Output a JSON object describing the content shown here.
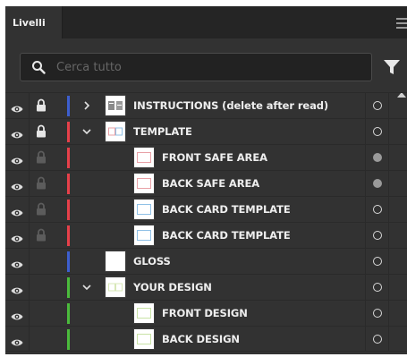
{
  "panel": {
    "tab_label": "Livelli",
    "search": {
      "placeholder": "Cerca tutto",
      "value": ""
    },
    "icons": {
      "search": "search-icon",
      "filter": "filter-icon",
      "menu": "menu-icon"
    }
  },
  "colors": {
    "blue": "#3d5fcf",
    "red": "#e6404a",
    "green": "#4bbb3c"
  },
  "layers": [
    {
      "label": "INSTRUCTIONS (delete after read)",
      "level": 0,
      "expander": "collapsed",
      "locked": true,
      "lock_style": "bright",
      "color": "#3d5fcf",
      "thumb": "instructions",
      "target": "empty"
    },
    {
      "label": "TEMPLATE",
      "level": 0,
      "expander": "expanded",
      "locked": true,
      "lock_style": "bright",
      "color": "#e6404a",
      "thumb": "template",
      "target": "empty"
    },
    {
      "label": "FRONT SAFE AREA",
      "level": 1,
      "expander": "none",
      "locked": true,
      "lock_style": "dim",
      "color": "#e6404a",
      "thumb": "red-frame",
      "target": "filled"
    },
    {
      "label": "BACK SAFE AREA",
      "level": 1,
      "expander": "none",
      "locked": true,
      "lock_style": "dim",
      "color": "#e6404a",
      "thumb": "red-frame",
      "target": "filled"
    },
    {
      "label": "BACK CARD TEMPLATE",
      "level": 1,
      "expander": "none",
      "locked": true,
      "lock_style": "dim",
      "color": "#e6404a",
      "thumb": "blue-frame",
      "target": "empty"
    },
    {
      "label": "BACK CARD TEMPLATE",
      "level": 1,
      "expander": "none",
      "locked": true,
      "lock_style": "dim",
      "color": "#e6404a",
      "thumb": "blue-frame",
      "target": "empty"
    },
    {
      "label": "GLOSS",
      "level": 0,
      "expander": "none",
      "locked": false,
      "lock_style": "none",
      "color": "#3d5fcf",
      "thumb": "blank",
      "target": "empty"
    },
    {
      "label": "YOUR DESIGN",
      "level": 0,
      "expander": "expanded",
      "locked": false,
      "lock_style": "none",
      "color": "#4bbb3c",
      "thumb": "design",
      "target": "empty"
    },
    {
      "label": "FRONT DESIGN",
      "level": 1,
      "expander": "none",
      "locked": false,
      "lock_style": "none",
      "color": "#4bbb3c",
      "thumb": "green-frame",
      "target": "empty"
    },
    {
      "label": "BACK DESIGN",
      "level": 1,
      "expander": "none",
      "locked": false,
      "lock_style": "none",
      "color": "#4bbb3c",
      "thumb": "green-frame",
      "target": "empty"
    }
  ]
}
